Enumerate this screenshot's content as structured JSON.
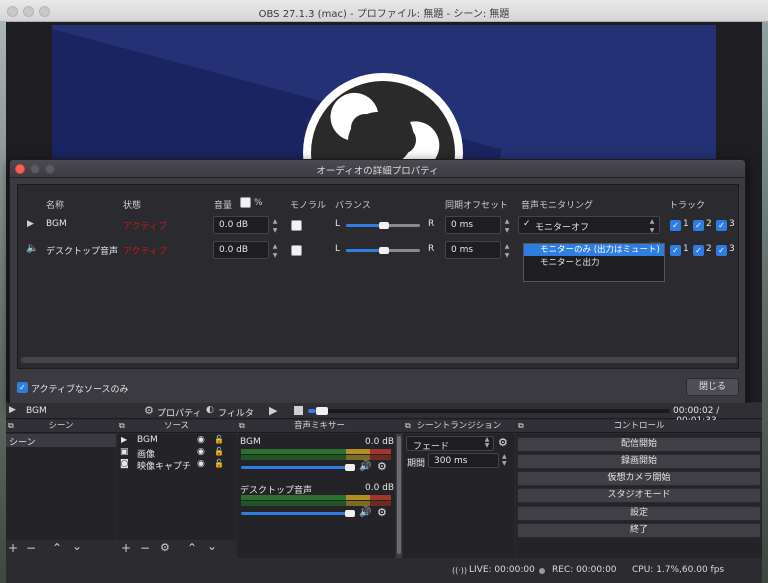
{
  "window": {
    "title": "OBS 27.1.3 (mac) - プロファイル: 無題 - シーン: 無題"
  },
  "dialog": {
    "title": "オーディオの詳細プロパティ",
    "headers": {
      "name": "名称",
      "status": "状態",
      "volume": "音量",
      "percent": "%",
      "mono": "モノラル",
      "balance": "バランス",
      "sync": "同期オフセット",
      "monitoring": "音声モニタリング",
      "tracks": "トラック"
    },
    "rows": [
      {
        "icon": "play-icon",
        "name": "BGM",
        "status": "アクティブ",
        "volume": "0.0 dB",
        "balance_left": "L",
        "balance_right": "R",
        "sync": "0 ms",
        "monitoring": "モニターオフ",
        "tracks": [
          "1",
          "2",
          "3"
        ]
      },
      {
        "icon": "speaker-icon",
        "name": "デスクトップ音声",
        "status": "アクティブ",
        "volume": "0.0 dB",
        "balance_left": "L",
        "balance_right": "R",
        "sync": "0 ms",
        "monitoring": "",
        "tracks": [
          "1",
          "2",
          "3"
        ]
      }
    ],
    "monitoring_options": [
      "モニターオフ",
      "モニターのみ (出力はミュート)",
      "モニターと出力"
    ],
    "monitoring_selected_index": 0,
    "active_only_label": "アクティブなソースのみ",
    "close_label": "閉じる"
  },
  "transport": {
    "source_name": "BGM",
    "properties_label": "プロパティ",
    "filters_label": "フィルタ",
    "time": "00:00:02 / -00:01:33"
  },
  "docks": {
    "scenes": {
      "title": "シーン",
      "items": [
        "シーン"
      ]
    },
    "sources": {
      "title": "ソース",
      "items": [
        {
          "icon": "play-icon",
          "label": "BGM"
        },
        {
          "icon": "image-icon",
          "label": "画像"
        },
        {
          "icon": "camera-icon",
          "label": "映像キャプチ"
        }
      ]
    },
    "mixer": {
      "title": "音声ミキサー",
      "channels": [
        {
          "name": "BGM",
          "level": "0.0 dB"
        },
        {
          "name": "デスクトップ音声",
          "level": "0.0 dB"
        }
      ]
    },
    "transitions": {
      "title": "シーントランジション",
      "type": "フェード",
      "duration_label": "期間",
      "duration": "300 ms"
    },
    "controls": {
      "title": "コントロール",
      "buttons": [
        "配信開始",
        "録画開始",
        "仮想カメラ開始",
        "スタジオモード",
        "設定",
        "終了"
      ]
    }
  },
  "status": {
    "live": "LIVE: 00:00:00",
    "rec": "REC: 00:00:00",
    "cpu": "CPU: 1.7%,60.00 fps"
  }
}
